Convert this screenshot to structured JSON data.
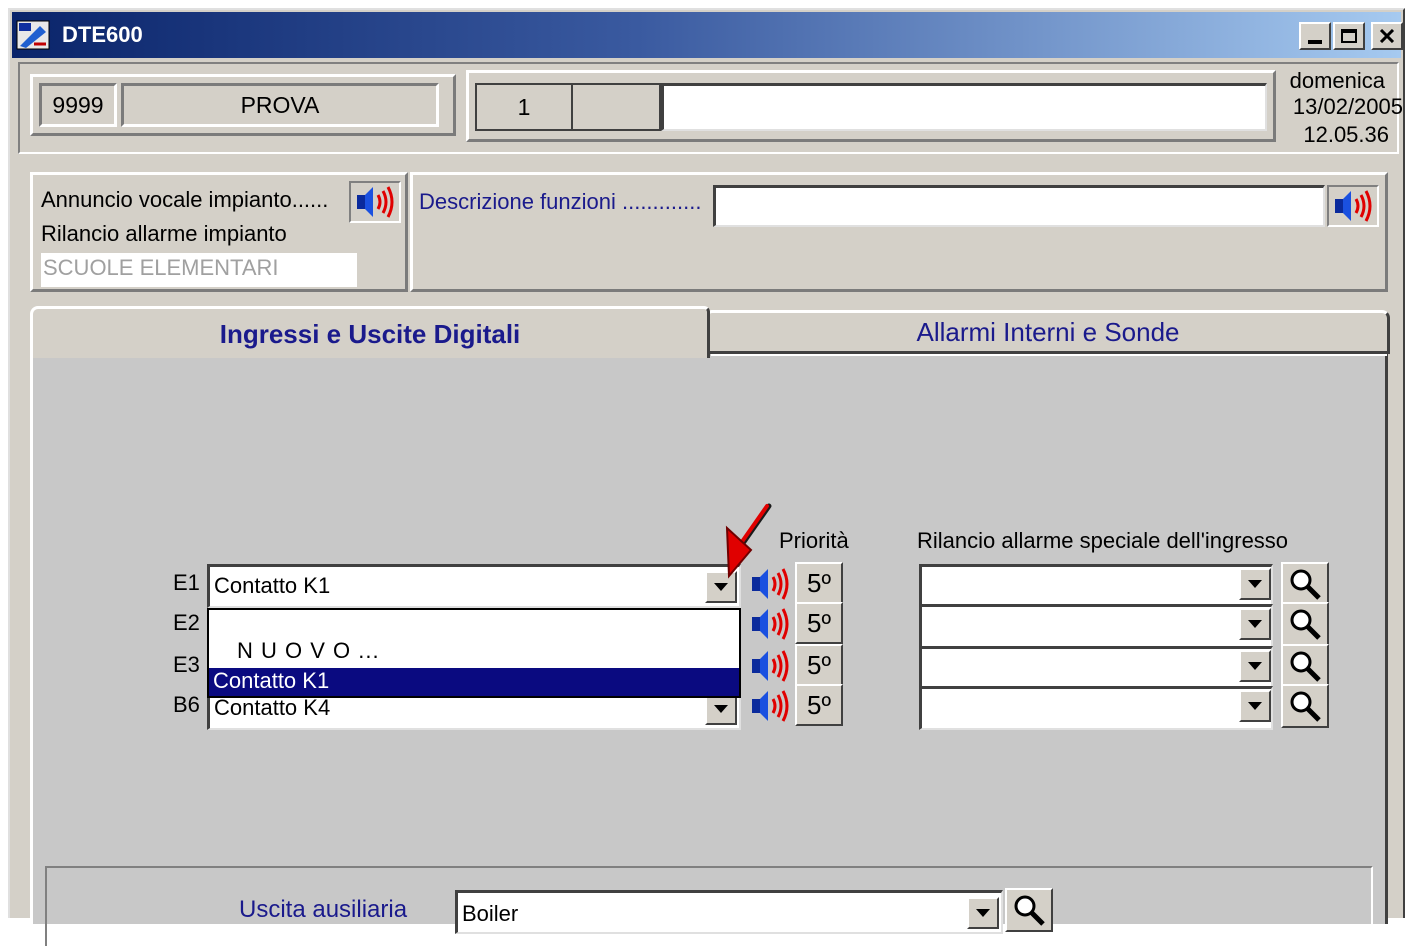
{
  "window": {
    "title": "DTE600",
    "minimize_label": "_",
    "maximize_label": "□",
    "close_label": "×"
  },
  "header": {
    "code": "9999",
    "name": "PROVA",
    "number": "1",
    "blank_field": "",
    "description_field": "",
    "day": "domenica",
    "date": "13/02/2005",
    "time": "12.05.36"
  },
  "info": {
    "voice_label": "Annuncio vocale impianto......",
    "relaunch_label": "Rilancio allarme impianto",
    "relaunch_value": "SCUOLE ELEMENTARI",
    "functions_label": "Descrizione funzioni .............",
    "functions_value": ""
  },
  "tabs": [
    {
      "label": "Ingressi e Uscite Digitali",
      "active": true
    },
    {
      "label": "Allarmi Interni e Sonde",
      "active": false
    }
  ],
  "inputs": {
    "priority_header": "Priorità",
    "relaunch_header": "Rilancio allarme speciale dell'ingresso",
    "rows": [
      {
        "label": "E1",
        "value": "Contatto K1",
        "priority": "5º",
        "relaunch": ""
      },
      {
        "label": "E2",
        "value": "",
        "priority": "5º",
        "relaunch": ""
      },
      {
        "label": "E3",
        "value": "",
        "priority": "5º",
        "relaunch": ""
      },
      {
        "label": "B6",
        "value": "Contatto K4",
        "priority": "5º",
        "relaunch": ""
      }
    ]
  },
  "dropdown_list": {
    "options": [
      "N U O V O ...",
      "Contatto K1"
    ],
    "selected_index": 1
  },
  "aux": {
    "label": "Uscita ausiliaria",
    "value": "Boiler"
  },
  "icons": {
    "speaker": "speaker-icon",
    "search": "magnifier-icon",
    "app": "app-icon",
    "annotation": "red-arrow-icon"
  },
  "colors": {
    "titlebar_start": "#0a246a",
    "titlebar_end": "#a6caf0",
    "selection": "#0a0a80",
    "label_blue": "#1a1a8c",
    "annotation_red": "#e00000"
  }
}
